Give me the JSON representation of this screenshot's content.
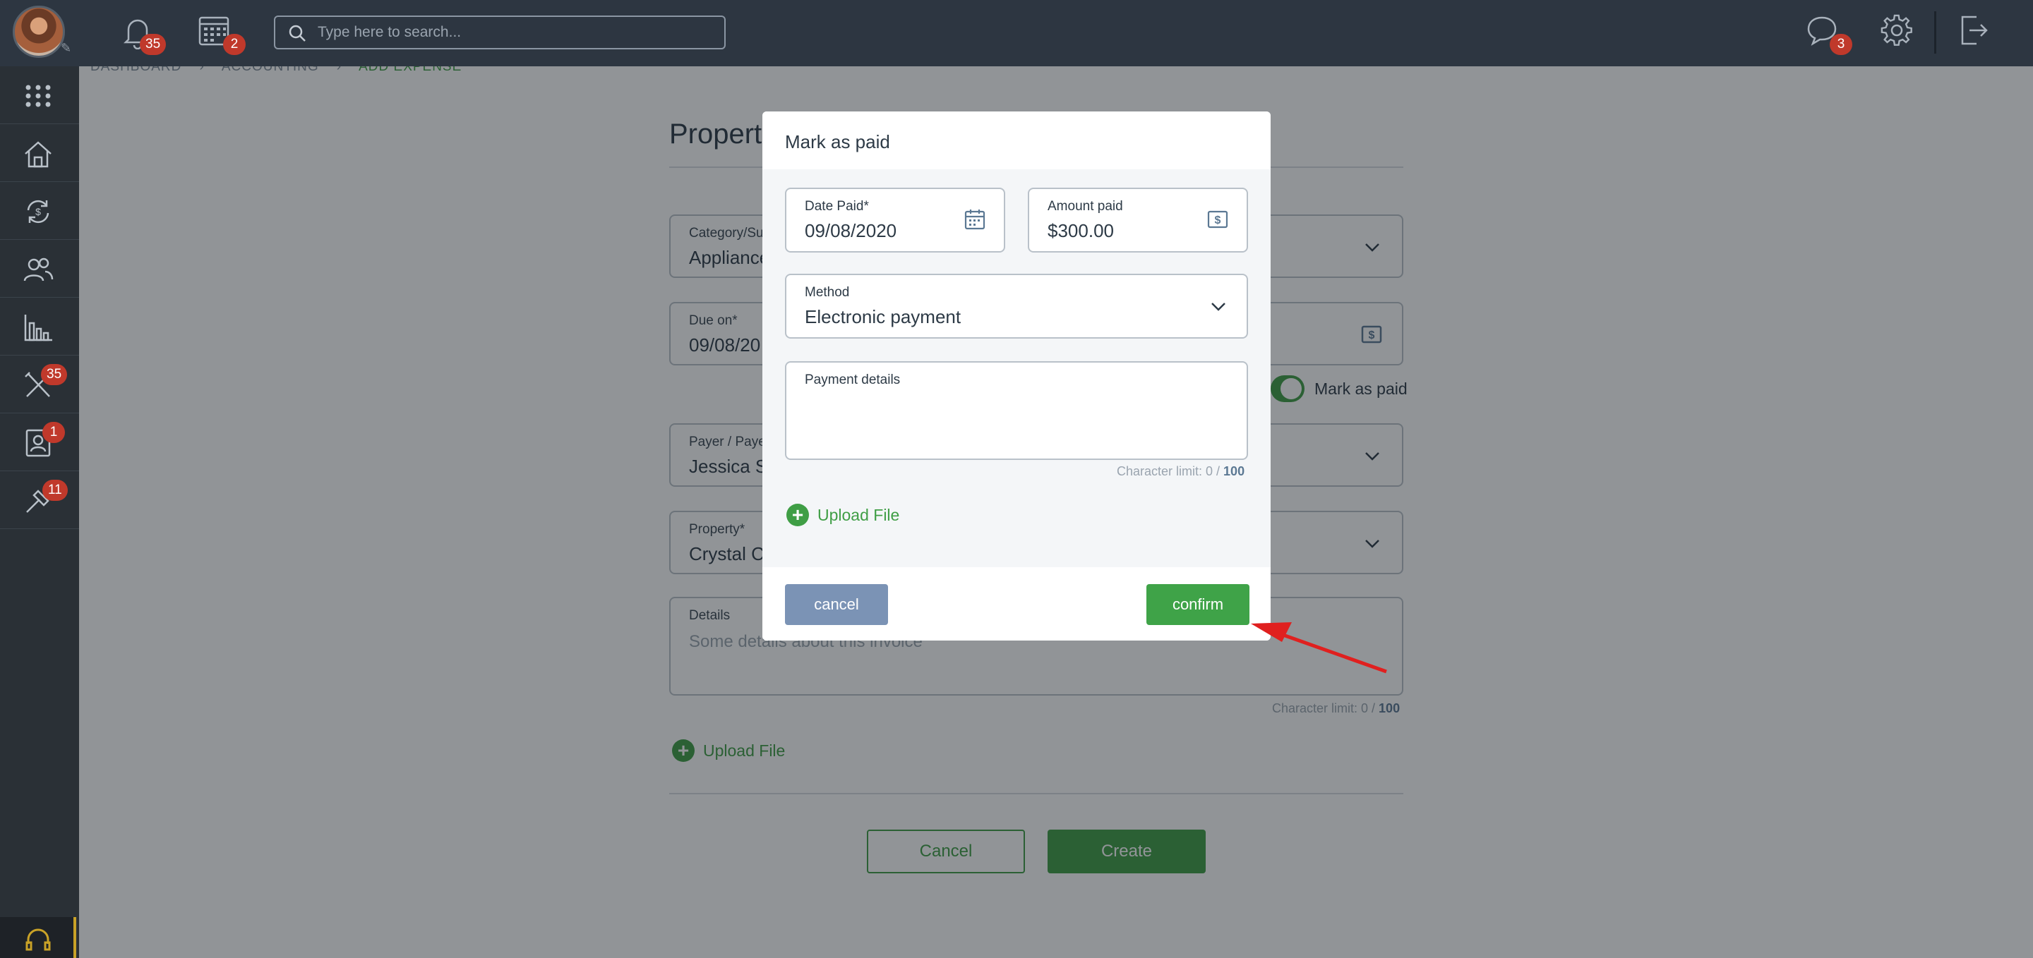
{
  "topbar": {
    "notifications_count": "35",
    "calendar_count": "2",
    "search_placeholder": "Type here to search...",
    "messages_count": "3"
  },
  "sidebar": {
    "items": [
      {
        "icon": "apps-grid-icon"
      },
      {
        "icon": "property-house-icon"
      },
      {
        "icon": "accounting-exchange-icon"
      },
      {
        "icon": "people-icon"
      },
      {
        "icon": "reports-chart-icon"
      },
      {
        "icon": "maintenance-tools-icon",
        "badge": "35"
      },
      {
        "icon": "contacts-card-icon",
        "badge": "1"
      },
      {
        "icon": "tools-link-icon",
        "badge": "11"
      }
    ]
  },
  "page": {
    "breadcrumb": {
      "first": "DASHBOARD",
      "second": "ACCOUNTING",
      "current": "ADD EXPENSE"
    },
    "title": "Propert",
    "category_label": "Category/Su",
    "category_value": "Appliance",
    "due_label": "Due on*",
    "due_value": "09/08/20",
    "mark_as_paid_label": "Mark as paid",
    "payer_label": "Payer / Paye",
    "payer_value": "Jessica S",
    "property_label": "Property*",
    "property_value": "Crystal C",
    "details_label": "Details",
    "details_placeholder": "Some details about this invoice",
    "char_limit_prefix": "Character limit: 0 / ",
    "char_limit_max": "100",
    "upload_label": "Upload File",
    "cancel_label": "Cancel",
    "create_label": "Create"
  },
  "modal": {
    "title": "Mark as paid",
    "date_paid_label": "Date Paid*",
    "date_paid_value": "09/08/2020",
    "amount_label": "Amount paid",
    "amount_value": "$300.00",
    "method_label": "Method",
    "method_value": "Electronic payment",
    "payment_details_label": "Payment details",
    "char_limit_prefix": "Character limit: 0 / ",
    "char_limit_max": "100",
    "upload_label": "Upload File",
    "cancel_label": "cancel",
    "confirm_label": "confirm"
  },
  "colors": {
    "topbar": "#2d3641",
    "sidebar": "#2a3036",
    "accent_green": "#3f9e45",
    "cancel_blue": "#7b93b5",
    "badge_red": "#c0392b",
    "annotation_arrow": "#e0201f"
  }
}
